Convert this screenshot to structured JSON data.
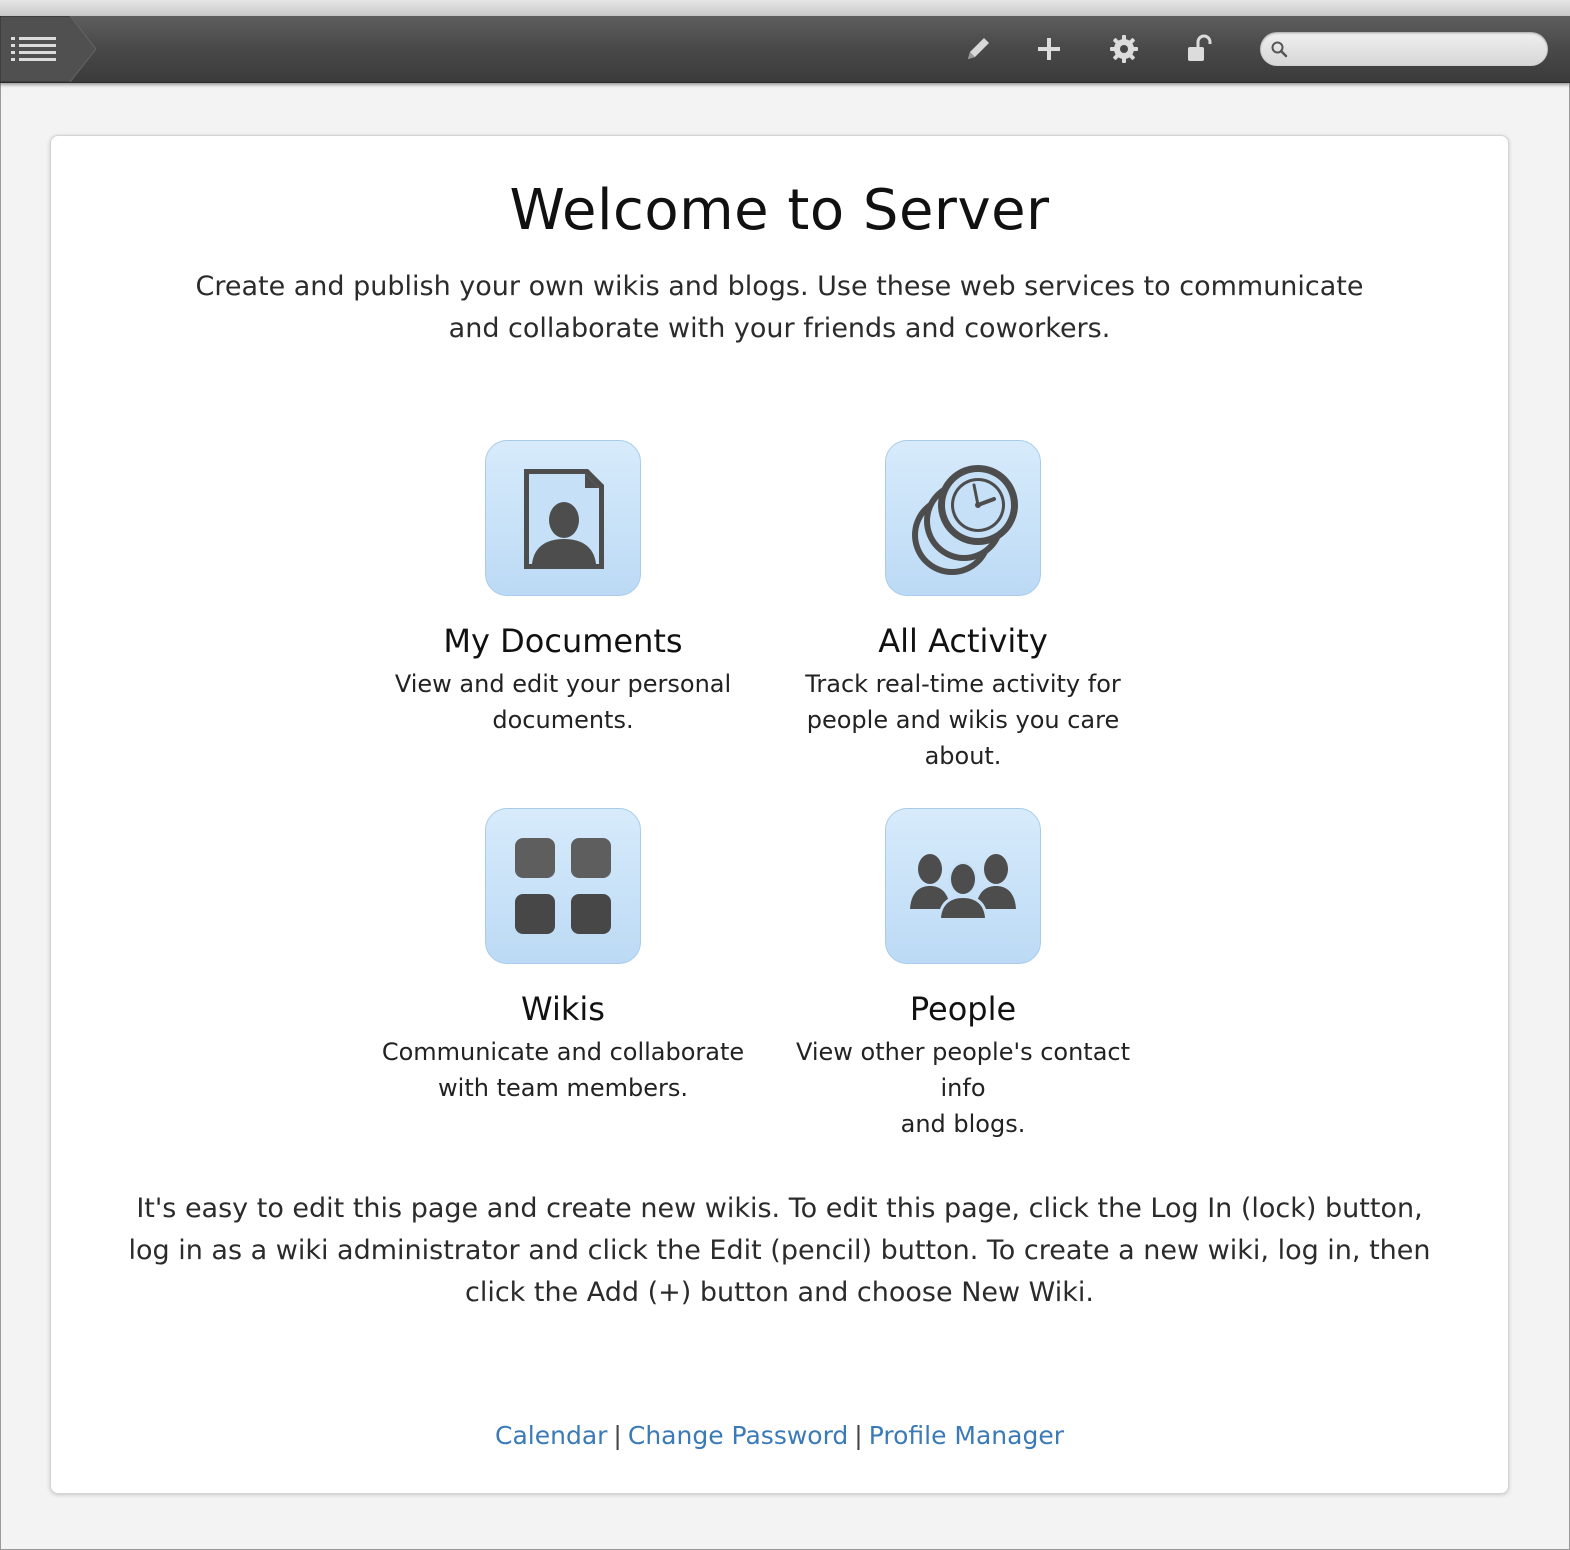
{
  "toolbar": {
    "menu_icon": "list-menu-icon",
    "icons": [
      "pencil-icon",
      "plus-icon",
      "gear-icon",
      "unlocked-lock-icon"
    ],
    "search": {
      "placeholder": "",
      "value": "",
      "icon": "search-icon"
    }
  },
  "welcome": {
    "title": "Welcome to Server",
    "intro": "Create and publish your own wikis and blogs. Use these web services to communicate and collaborate with your friends and coworkers."
  },
  "tiles": [
    {
      "icon": "document-person-icon",
      "title": "My Documents",
      "desc_line1": "View and edit your personal",
      "desc_line2": "documents."
    },
    {
      "icon": "activity-clock-icon",
      "title": "All Activity",
      "desc_line1": "Track real-time activity for",
      "desc_line2": "people and wikis you care about."
    },
    {
      "icon": "wikis-grid-icon",
      "title": "Wikis",
      "desc_line1": "Communicate and collaborate",
      "desc_line2": "with team members."
    },
    {
      "icon": "people-group-icon",
      "title": "People",
      "desc_line1": "View other people's contact info",
      "desc_line2": "and blogs."
    }
  ],
  "help_text": "It's easy to edit this page and create new wikis. To edit this page, click the Log In (lock) button, log in as a wiki administrator and click the Edit (pencil) button. To create a new wiki, log in, then click the Add (+) button and choose New Wiki.",
  "footer": {
    "links": [
      "Calendar",
      "Change Password",
      "Profile Manager"
    ],
    "separator": "|",
    "link_color": "#3a7ab8"
  },
  "colors": {
    "toolbar": "#4a4a4a",
    "icon_tile": "#c8e2f8",
    "link": "#3a7ab8"
  }
}
